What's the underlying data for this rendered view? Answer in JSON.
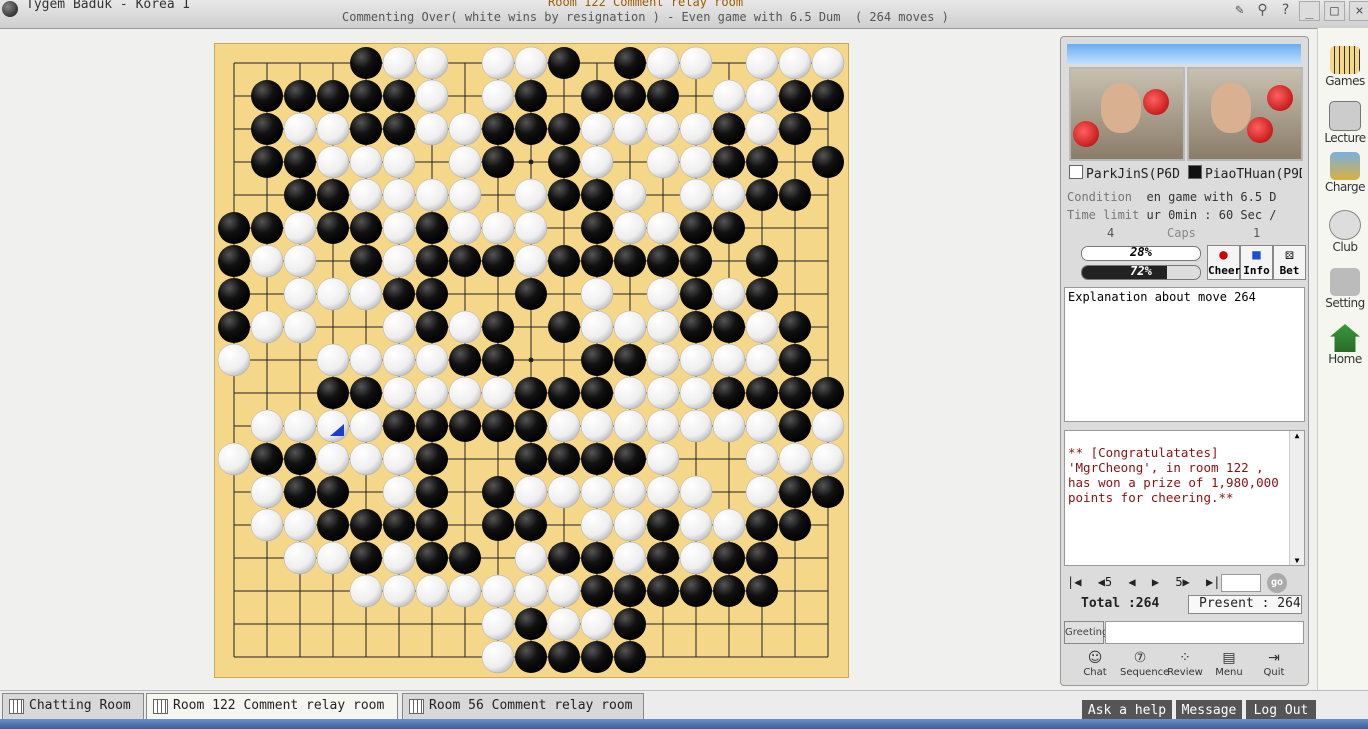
{
  "window": {
    "app_title": "Tygem Baduk - Korea I",
    "room_title": "Room 122 Comment relay room",
    "status": "Commenting Over( white wins by resignation ) - Even game with 6.5 Dum  ( 264 moves )"
  },
  "board": {
    "size": 19,
    "rows": [
      "....XOO.OOX.XOO.OOO",
      ".XXXXXO.OX.XXX.OOXX",
      ".XOOXXOOXXXOOOOXOX.",
      ".XXOOO.OX.XO.OOXX.X",
      "..XXOOOO.OXXO.OOXX.",
      "XXOXXOXOOO.XOOXX...",
      "XOO.XOXXXOXXXXX.X..",
      "X.OOOXX..X.O.OXOX..",
      "XOO..OXOX.XOOOXXOX.",
      "O..OOOOXX..XXOOOOX.",
      "...XXOOOOXXXOOOXXXX",
      ".OOOOXXXXXOOOOOOOXO",
      "OXXOOOX..XXXXO..OOO",
      ".OXX.OX.XOOOOOO.OXX",
      ".OOXXXX.XX.OOXOOXX.",
      "..OOXOXX.OXXOXOXX..",
      "....OOOOOOOXXXXXX..",
      "........OXOOX......",
      "........OXXXX......"
    ],
    "last_move": "D8"
  },
  "panel": {
    "player_white": "ParkJinS(P6D",
    "player_black": "PiaoTHuan(P9D",
    "condition_label": "Condition",
    "condition_value": "en game with 6.5 D",
    "time_label": "Time limit",
    "time_value": "ur 0min : 60 Sec /",
    "caps_white": "4",
    "caps_label": "Caps",
    "caps_black": "1",
    "win_white_label": "28%",
    "win_white_fraction": 0.28,
    "win_black_label": "72%",
    "win_black_fraction": 0.72,
    "cheer_label": "Cheer",
    "info_label": "Info",
    "bet_label": "Bet",
    "explanation": "Explanation about move 264",
    "chat_text": "** [Congratulatates] 'MgrCheong', in room 122 , has won a prize of 1,980,000 points for cheering.**",
    "nav": {
      "first": "|◀",
      "back5": "◀5",
      "prev": "◀",
      "next": "▶",
      "fwd5": "5▶",
      "last": "▶|",
      "go": "go"
    },
    "total": "Total :264",
    "present": "Present : 264",
    "greeting_label": "Greeting",
    "tools": [
      "Chat",
      "Sequence",
      "Review",
      "Menu",
      "Quit"
    ]
  },
  "sidebar": [
    "Games",
    "Lecture",
    "Charge",
    "Club",
    "Setting",
    "Home"
  ],
  "tabs": [
    "Chatting Room",
    "Room 122 Comment relay room",
    "Room 56 Comment relay room"
  ],
  "bottom_buttons": [
    "Ask a help",
    "Message",
    "Log Out"
  ],
  "colors": {
    "board": "#f5d789",
    "accent_blue": "#1a3fd0",
    "brand_dark": "#555555"
  }
}
